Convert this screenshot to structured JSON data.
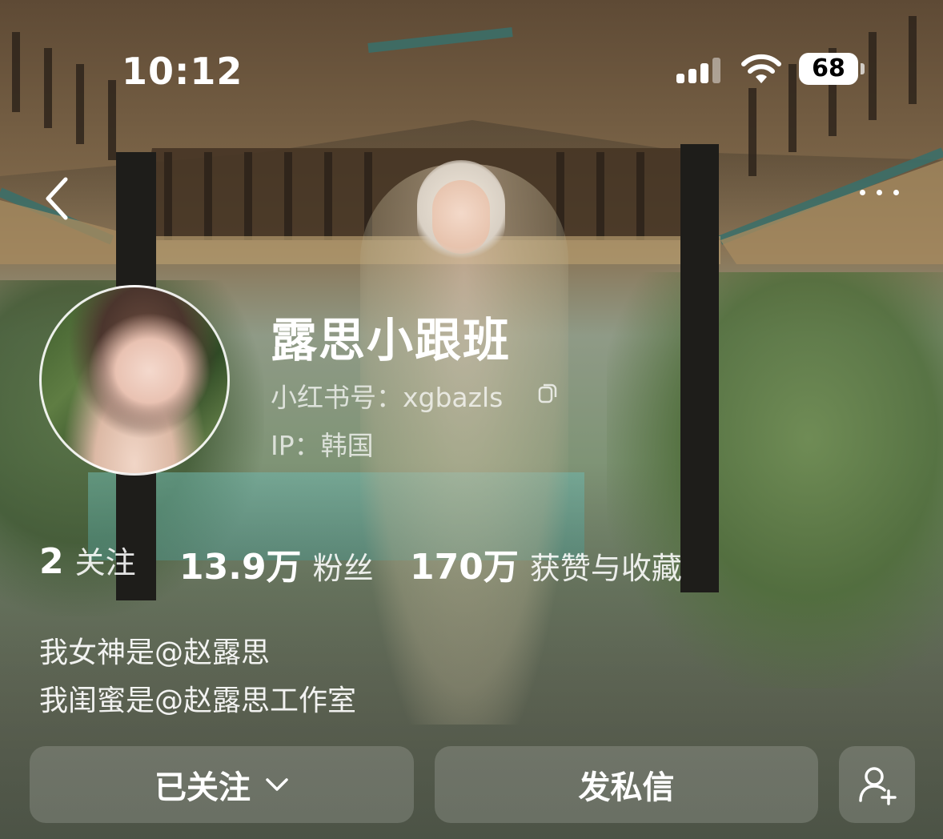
{
  "status_bar": {
    "time": "10:12",
    "battery": "68"
  },
  "profile": {
    "name": "露思小跟班",
    "red_id": "小红书号：xgbazls",
    "ip": "IP：韩国"
  },
  "stats": [
    {
      "value": "2",
      "label": "关注"
    },
    {
      "value": "13.9万",
      "label": "粉丝"
    },
    {
      "value": "170万",
      "label": "获赞与收藏"
    }
  ],
  "bio": [
    "我女神是@赵露思",
    "我闺蜜是@赵露思工作室"
  ],
  "actions": {
    "follow_label": "已关注",
    "message_label": "发私信"
  },
  "icons": [
    "back-icon",
    "more-icon",
    "copy-icon",
    "chevron-down-icon",
    "add-friend-icon",
    "signal-icon",
    "wifi-icon",
    "battery-icon"
  ]
}
